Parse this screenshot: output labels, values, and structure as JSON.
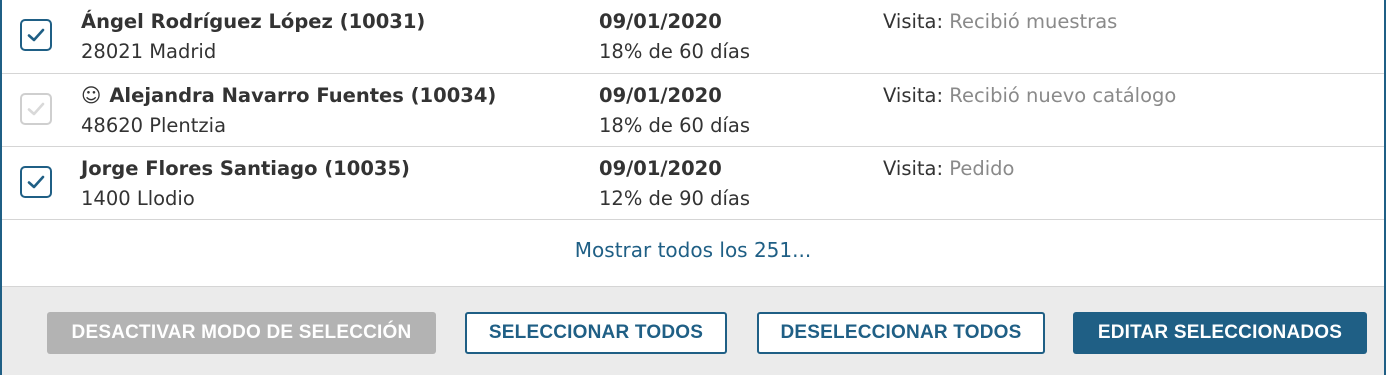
{
  "rows": [
    {
      "checked": true,
      "has_smile_icon": false,
      "name": "Ángel Rodríguez López (10031)",
      "address": "28021 Madrid",
      "date": "09/01/2020",
      "discount": "18% de 60 días",
      "visit_label": "Visita:",
      "visit_value": "Recibió muestras"
    },
    {
      "checked": false,
      "has_smile_icon": true,
      "smile": "☺",
      "name": "Alejandra Navarro Fuentes (10034)",
      "address": "48620 Plentzia",
      "date": "09/01/2020",
      "discount": "18% de 60 días",
      "visit_label": "Visita:",
      "visit_value": "Recibió nuevo catálogo"
    },
    {
      "checked": true,
      "has_smile_icon": false,
      "name": "Jorge Flores Santiago (10035)",
      "address": "1400 Llodio",
      "date": "09/01/2020",
      "discount": "12% de 90 días",
      "visit_label": "Visita:",
      "visit_value": "Pedido"
    }
  ],
  "show_all": "Mostrar todos los 251...",
  "footer": {
    "deactivate_label": "DESACTIVAR MODO DE SELECCIÓN",
    "select_all_label": "SELECCIONAR TODOS",
    "deselect_all_label": "DESELECCIONAR TODOS",
    "edit_selected_label": "EDITAR SELECCIONADOS"
  },
  "colors": {
    "accent": "#1f5f85",
    "disabled": "#b3b3b3",
    "footer_bg": "#ebebeb",
    "muted_text": "#8a8a8a"
  }
}
